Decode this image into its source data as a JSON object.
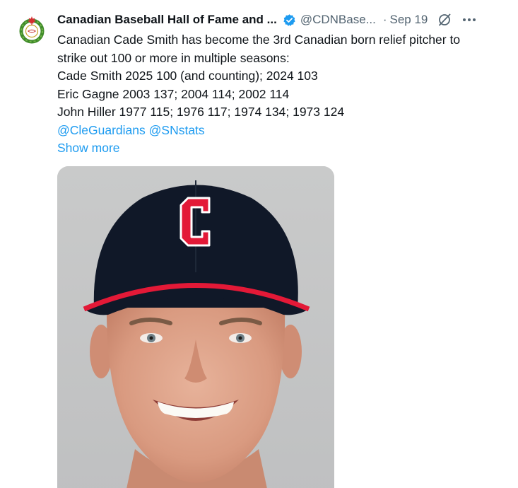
{
  "tweet": {
    "display_name": "Canadian Baseball Hall of Fame and ...",
    "handle": "@CDNBase...",
    "dot": "·",
    "time": "Sep 19",
    "icons": {
      "avatar": "maple-leaf-wreath-logo",
      "verified": "verified-badge-icon",
      "grok": "grok-icon",
      "more": "more-options-icon"
    },
    "text_lines": [
      "Canadian Cade Smith has become the 3rd Canadian born relief pitcher to",
      "strike out 100 or more in multiple seasons:",
      "Cade Smith 2025 100 (and counting); 2024 103",
      "Eric Gagne 2003 137; 2004 114; 2002 114",
      "John Hiller 1977 115; 1976 117; 1974 134; 1973 124"
    ],
    "mentions": [
      "@CleGuardians",
      "@SNstats"
    ],
    "show_more": "Show more",
    "media_alt": "player-headshot-photo",
    "cap_letter": "C"
  },
  "colors": {
    "link": "#1d9bf0",
    "secondary": "#536471",
    "text": "#0f1419",
    "cap_navy": "#101828",
    "cap_red": "#e31937"
  }
}
